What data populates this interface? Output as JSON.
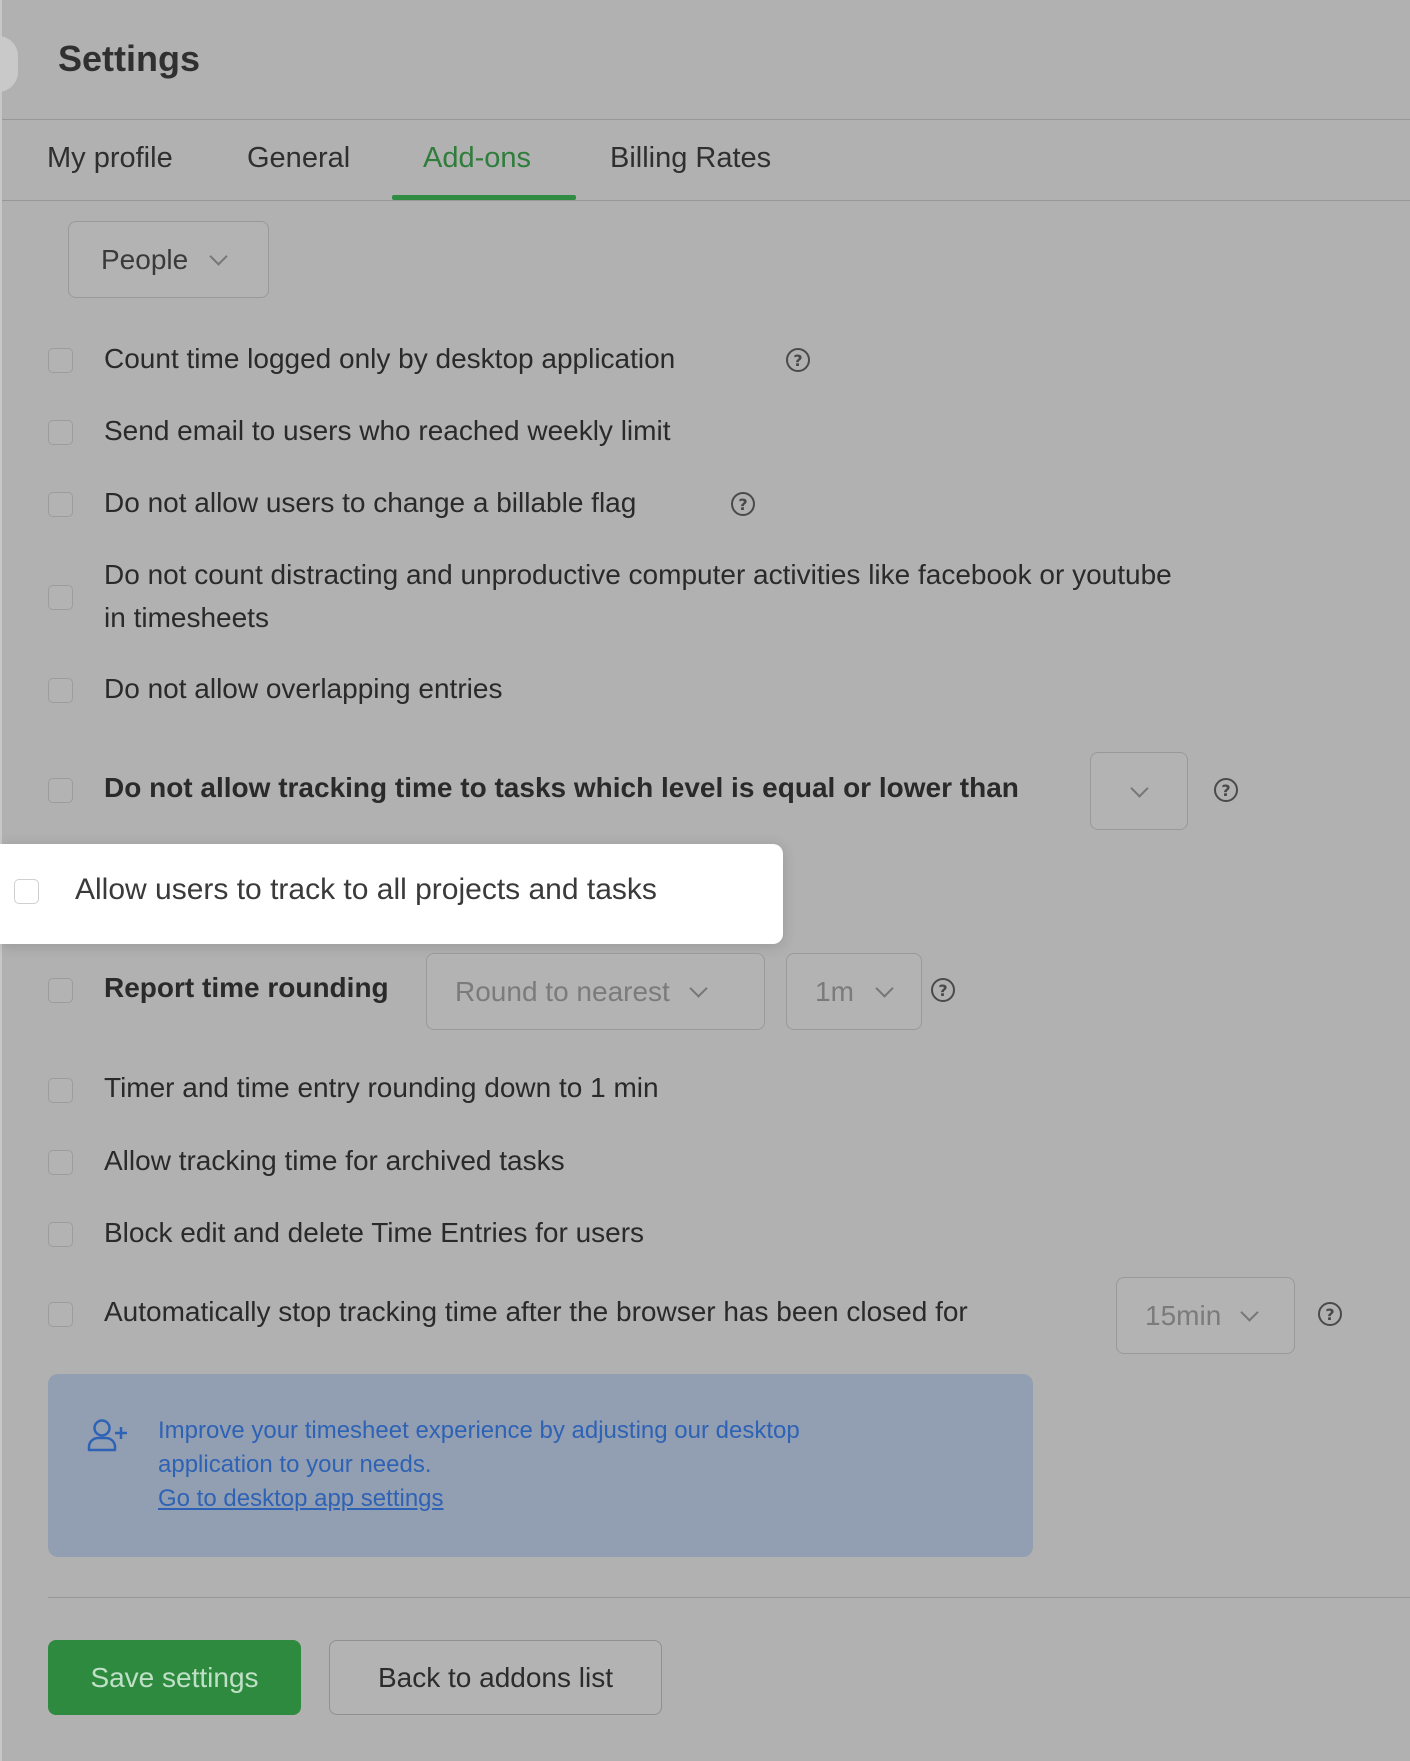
{
  "header": {
    "title": "Settings"
  },
  "tabs": [
    {
      "label": "My profile",
      "active": false
    },
    {
      "label": "General",
      "active": false
    },
    {
      "label": "Add-ons",
      "active": true
    },
    {
      "label": "Billing Rates",
      "active": false
    }
  ],
  "filter": {
    "selected": "People"
  },
  "options": [
    {
      "label": "Count time logged only by desktop application",
      "checked": false
    },
    {
      "label": "Send email to users who reached weekly limit",
      "checked": false
    },
    {
      "label": "Do not allow users to change a billable flag",
      "checked": false
    },
    {
      "label_line1": "Do not count distracting and unproductive computer activities like facebook or youtube",
      "label_line2": "in timesheets",
      "checked": false
    },
    {
      "label": "Do not allow overlapping entries",
      "checked": false
    },
    {
      "label": "Do not allow tracking time to tasks which level is equal or lower than",
      "checked": false,
      "select_value": ""
    },
    {
      "label": "Allow users to track to all projects and tasks",
      "checked": false,
      "highlighted": true
    },
    {
      "label": "Report time rounding",
      "checked": false,
      "rounding_mode": "Round to nearest",
      "rounding_interval": "1m"
    },
    {
      "label": "Timer and time entry rounding down to 1 min",
      "checked": false
    },
    {
      "label": "Allow tracking time for archived tasks",
      "checked": false
    },
    {
      "label": "Block edit and delete Time Entries for users",
      "checked": false
    },
    {
      "label": "Automatically stop tracking time after the browser has been closed for",
      "checked": false,
      "select_value": "15min"
    }
  ],
  "help_icon": "?",
  "info": {
    "icon": "add-user-icon",
    "line1": "Improve your timesheet experience by adjusting our desktop",
    "line2": "application to your needs.",
    "link": "Go to desktop app settings"
  },
  "actions": {
    "save": "Save settings",
    "back": "Back to addons list"
  },
  "colors": {
    "accent": "#2e8a3f",
    "info_text": "#2e62b5",
    "overlay": "#b1b1b1"
  }
}
